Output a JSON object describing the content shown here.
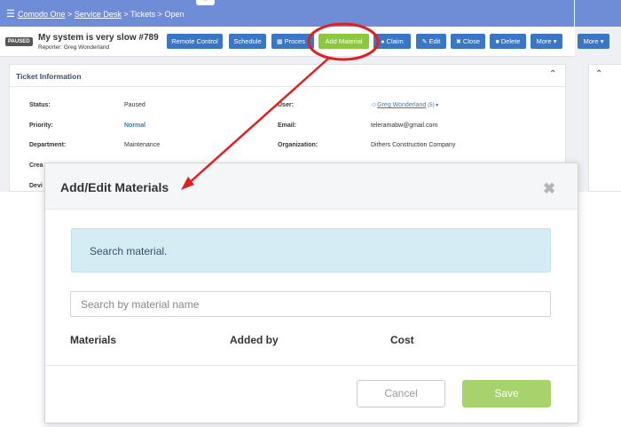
{
  "topbar": {
    "breadcrumb": [
      "Comodo One",
      "Service Desk",
      "Tickets",
      "Open"
    ],
    "sep": ">"
  },
  "ticket": {
    "status_badge": "PAUSED",
    "title": "My system is very slow #789",
    "reporter": "Reporter: Greg Wonderland"
  },
  "actions": {
    "remote_control": "Remote Control",
    "schedule": "Schedule",
    "process": "Proces",
    "add_material": "Add Material",
    "claim": "Claim",
    "edit": "Edit",
    "close": "Close",
    "delete": "Delete",
    "more": "More",
    "more_right": "More"
  },
  "info": {
    "title": "Ticket Information",
    "status_label": "Status:",
    "status_value": "Paused",
    "priority_label": "Priority:",
    "priority_value": "Normal",
    "department_label": "Department:",
    "department_value": "Maintenance",
    "user_label": "User:",
    "user_value": "Greg Wonderland",
    "user_count": "(5)",
    "email_label": "Email:",
    "email_value": "teleramabw@gmail.com",
    "organization_label": "Organization:",
    "organization_value": "Dithers Construction Company",
    "partial_label_1": "Crea",
    "partial_label_2": "Devi"
  },
  "modal": {
    "title": "Add/Edit Materials",
    "info": "Search material.",
    "search_placeholder": "Search by material name",
    "col_materials": "Materials",
    "col_added_by": "Added by",
    "col_cost": "Cost",
    "cancel": "Cancel",
    "save": "Save"
  },
  "colors": {
    "topbar": "#6f8dd7",
    "primary_button": "#3a76c4",
    "add_material": "#8dc63f",
    "annotation": "#e02020"
  }
}
